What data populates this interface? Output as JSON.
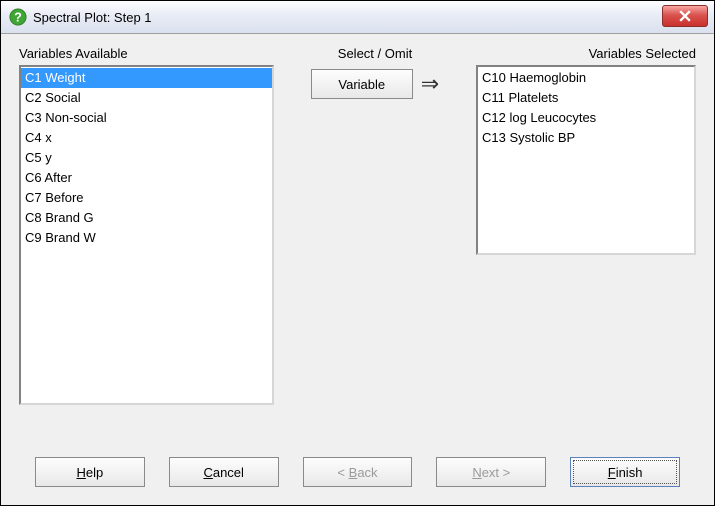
{
  "window": {
    "title": "Spectral Plot: Step 1"
  },
  "labels": {
    "available": "Variables Available",
    "select_omit": "Select / Omit",
    "selected": "Variables Selected"
  },
  "available": [
    "C1 Weight",
    "C2 Social",
    "C3 Non-social",
    "C4 x",
    "C5 y",
    "C6 After",
    "C7 Before",
    "C8 Brand G",
    "C9 Brand W"
  ],
  "selected": [
    "C10 Haemoglobin",
    "C11 Platelets",
    "C12 log Leucocytes",
    "C13 Systolic BP"
  ],
  "buttons": {
    "variable": "Variable",
    "help_u": "H",
    "help_r": "elp",
    "cancel_u": "C",
    "cancel_r": "ancel",
    "back_l": "< ",
    "back_u": "B",
    "back_r": "ack",
    "next_u": "N",
    "next_r": "ext >",
    "finish_u": "F",
    "finish_r": "inish"
  }
}
